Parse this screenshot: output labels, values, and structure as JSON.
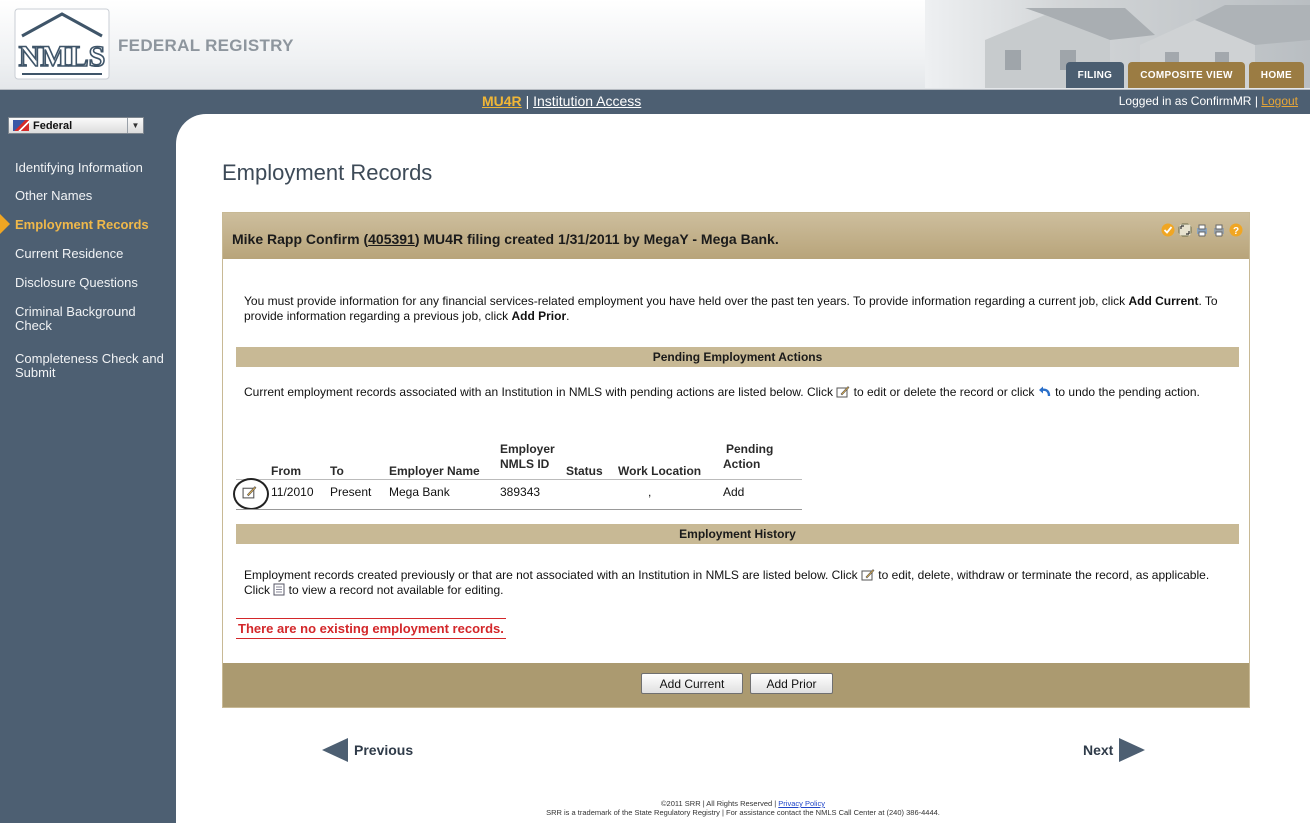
{
  "header": {
    "brand": "FEDERAL REGISTRY",
    "logo_text": "NMLS",
    "tabs": [
      {
        "label": "FILING",
        "active": true
      },
      {
        "label": "COMPOSITE VIEW",
        "active": false
      },
      {
        "label": "HOME",
        "active": false
      }
    ]
  },
  "navbar": {
    "code": "MU4R",
    "separator": "|",
    "context": "Institution Access",
    "logged_in": "Logged in as ConfirmMR",
    "logout": "Logout"
  },
  "sidebar": {
    "selector": "Federal",
    "items": [
      {
        "label": "Identifying Information",
        "active": false
      },
      {
        "label": "Other Names",
        "active": false
      },
      {
        "label": "Employment Records",
        "active": true
      },
      {
        "label": "Current Residence",
        "active": false
      },
      {
        "label": "Disclosure Questions",
        "active": false
      },
      {
        "label": "Criminal Background Check",
        "active": false
      },
      {
        "label": "Completeness Check and Submit",
        "active": false
      }
    ]
  },
  "main": {
    "title": "Employment Records",
    "panel": {
      "head_prefix": "Mike Rapp Confirm (",
      "head_number": "405391",
      "head_suffix": ") MU4R filing created 1/31/2011 by MegaY - Mega Bank.",
      "intro_part1": "You must provide information for any financial services-related employment you have held over the past ten years. To provide information regarding a current job, click ",
      "intro_bold1": "Add Current",
      "intro_part2": ". To provide information regarding a previous job, click ",
      "intro_bold2": "Add Prior",
      "intro_part3": ".",
      "pending_title": "Pending Employment Actions",
      "pending_text1": "Current employment records associated with an Institution in NMLS with pending actions are listed below. Click ",
      "pending_text2": " to edit or delete the record or click ",
      "pending_text3": " to undo the pending action.",
      "table": {
        "headers": {
          "from": "From",
          "to": "To",
          "employer_name": "Employer Name",
          "nmls_id_line1": "Employer",
          "nmls_id_line2": "NMLS ID",
          "status": "Status",
          "work_location": "Work Location",
          "pending_line1": "Pending",
          "pending_line2": "Action"
        },
        "rows": [
          {
            "from": "11/2010",
            "to": "Present",
            "employer_name": "Mega Bank",
            "nmls_id": "389343",
            "status": "",
            "work_location": ",",
            "pending_action": "Add"
          }
        ]
      },
      "history_title": "Employment History",
      "history_text1": "Employment records created previously or that are not associated with an Institution in NMLS are listed below. Click ",
      "history_text2": " to edit, delete, withdraw or terminate the record, as applicable. Click ",
      "history_text3": " to view a record not available for editing.",
      "no_records": "There are no existing employment records.",
      "buttons": {
        "add_current": "Add Current",
        "add_prior": "Add Prior"
      }
    },
    "prev_label": "Previous",
    "next_label": "Next"
  },
  "footer": {
    "line1_prefix": "©2011 SRR | All Rights Reserved | ",
    "privacy": "Privacy Policy",
    "line2": "SRR is a trademark of the State Regulatory Registry | For assistance contact the NMLS Call Center at (240) 386-4444."
  },
  "colors": {
    "nav": "#4d5f72",
    "accent_gold": "#f0b84a",
    "panel_tan": "#c8b995",
    "error_red": "#d3272a"
  }
}
